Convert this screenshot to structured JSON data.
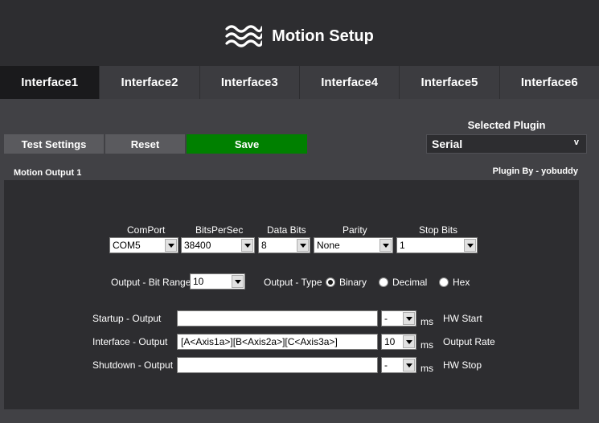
{
  "header": {
    "title": "Motion Setup",
    "icon": "waves-icon"
  },
  "tabs": [
    {
      "label": "Interface1",
      "active": true
    },
    {
      "label": "Interface2",
      "active": false
    },
    {
      "label": "Interface3",
      "active": false
    },
    {
      "label": "Interface4",
      "active": false
    },
    {
      "label": "Interface5",
      "active": false
    },
    {
      "label": "Interface6",
      "active": false
    }
  ],
  "toolbar": {
    "test_label": "Test Settings",
    "reset_label": "Reset",
    "save_label": "Save",
    "save_color": "#008000"
  },
  "plugin": {
    "label": "Selected Plugin",
    "selected": "Serial",
    "chevron": "v",
    "by": "Plugin By - yobuddy"
  },
  "section": {
    "label": "Motion Output 1"
  },
  "serial": {
    "comport": {
      "label": "ComPort",
      "value": "COM5"
    },
    "bits_per_sec": {
      "label": "BitsPerSec",
      "value": "38400"
    },
    "data_bits": {
      "label": "Data Bits",
      "value": "8"
    },
    "parity": {
      "label": "Parity",
      "value": "None"
    },
    "stop_bits": {
      "label": "Stop Bits",
      "value": "1"
    }
  },
  "output": {
    "bit_range_label": "Output - Bit Range",
    "bit_range_value": "10",
    "type_label": "Output - Type",
    "types": [
      {
        "label": "Binary",
        "checked": true
      },
      {
        "label": "Decimal",
        "checked": false
      },
      {
        "label": "Hex",
        "checked": false
      }
    ]
  },
  "rows": {
    "startup": {
      "label": "Startup - Output",
      "value": "",
      "ms_value": "-",
      "ms": "ms",
      "hw": "HW Start"
    },
    "interface": {
      "label": "Interface - Output",
      "value": "[A<Axis1a>][B<Axis2a>][C<Axis3a>]",
      "ms_value": "10",
      "ms": "ms",
      "hw": "Output Rate"
    },
    "shutdown": {
      "label": "Shutdown - Output",
      "value": "",
      "ms_value": "-",
      "ms": "ms",
      "hw": "HW Stop"
    }
  }
}
